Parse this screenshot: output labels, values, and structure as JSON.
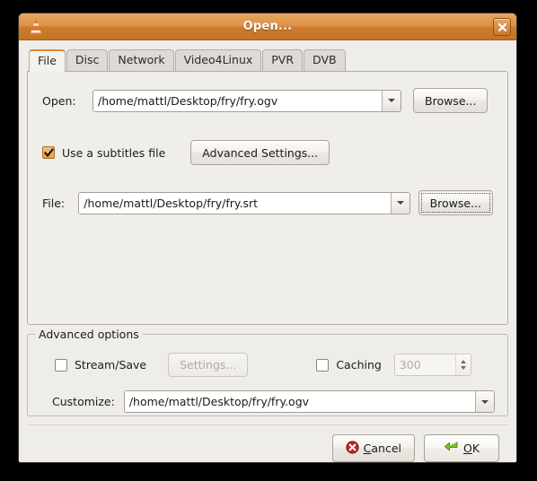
{
  "window": {
    "title": "Open...",
    "app_icon": "vlc-cone-icon",
    "close_label": "close-icon"
  },
  "tabs": [
    {
      "label": "File",
      "active": true
    },
    {
      "label": "Disc",
      "active": false
    },
    {
      "label": "Network",
      "active": false
    },
    {
      "label": "Video4Linux",
      "active": false
    },
    {
      "label": "PVR",
      "active": false
    },
    {
      "label": "DVB",
      "active": false
    }
  ],
  "file_tab": {
    "open_label": "Open:",
    "open_value": "/home/mattl/Desktop/fry/fry.ogv",
    "open_browse_label": "Browse...",
    "subtitles_checkbox_label": "Use a subtitles file",
    "subtitles_checked": true,
    "advanced_settings_label": "Advanced Settings...",
    "file_label": "File:",
    "file_value": "/home/mattl/Desktop/fry/fry.srt",
    "file_browse_label": "Browse..."
  },
  "advanced_options": {
    "legend": "Advanced options",
    "stream_save_label": "Stream/Save",
    "stream_save_checked": false,
    "settings_label": "Settings...",
    "settings_disabled": true,
    "caching_label": "Caching",
    "caching_checked": false,
    "caching_value": "300",
    "caching_disabled": true,
    "customize_label": "Customize:",
    "customize_value": "/home/mattl/Desktop/fry/fry.ogv"
  },
  "actions": {
    "cancel_label": "Cancel",
    "cancel_mnemonic": "C",
    "ok_label": "OK",
    "ok_mnemonic": "O",
    "cancel_icon": "cancel-icon",
    "ok_icon": "enter-arrow-icon"
  },
  "colors": {
    "titlebar_top": "#e7a761",
    "titlebar_bottom": "#c27425",
    "active_tab_accent": "#e08a2c",
    "checkbox_checked": "#e8a049",
    "cancel_red": "#cc2222",
    "ok_green": "#73b52a",
    "window_bg": "#efedea"
  }
}
